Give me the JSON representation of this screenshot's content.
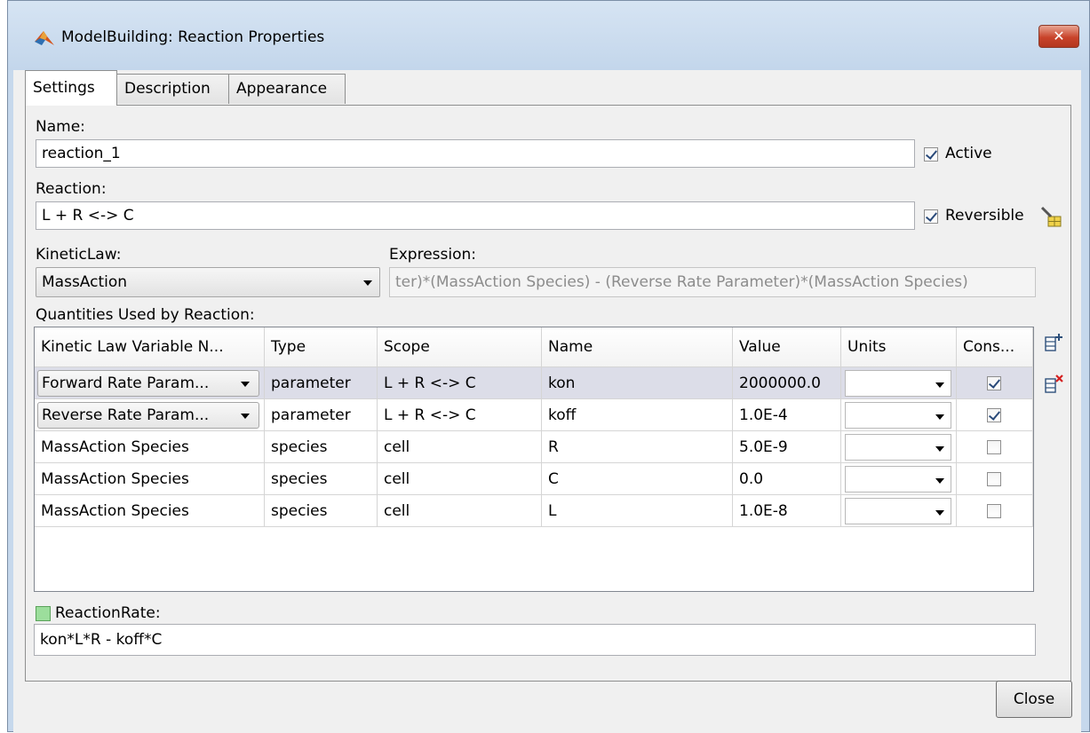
{
  "window": {
    "title": "ModelBuilding: Reaction Properties",
    "close_glyph": "✕"
  },
  "tabs": [
    {
      "label": "Settings",
      "active": true
    },
    {
      "label": "Description",
      "active": false
    },
    {
      "label": "Appearance",
      "active": false
    }
  ],
  "form": {
    "name_label": "Name:",
    "name_value": "reaction_1",
    "active_label": "Active",
    "active_checked": true,
    "reaction_label": "Reaction:",
    "reaction_value": "L + R <-> C",
    "reversible_label": "Reversible",
    "reversible_checked": true,
    "kinetic_law_label": "KineticLaw:",
    "kinetic_law_value": "MassAction",
    "expression_label": "Expression:",
    "expression_value": "ter)*(MassAction Species) - (Reverse Rate Parameter)*(MassAction Species)",
    "quantities_label": "Quantities Used by Reaction:",
    "reaction_rate_label": "ReactionRate:",
    "reaction_rate_value": "kon*L*R - koff*C"
  },
  "table": {
    "headers": [
      "Kinetic Law Variable N...",
      "Type",
      "Scope",
      "Name",
      "Value",
      "Units",
      "Cons..."
    ],
    "rows": [
      {
        "variable": "Forward Rate Param...",
        "type": "parameter",
        "scope": "L + R <-> C",
        "name": "kon",
        "value": "2000000.0",
        "units": "",
        "constant": true,
        "selected": true
      },
      {
        "variable": "Reverse Rate Param...",
        "type": "parameter",
        "scope": "L + R <-> C",
        "name": "koff",
        "value": "1.0E-4",
        "units": "",
        "constant": true,
        "selected": false
      },
      {
        "variable": "MassAction Species",
        "type": "species",
        "scope": "cell",
        "name": "R",
        "value": "5.0E-9",
        "units": "",
        "constant": false,
        "selected": false
      },
      {
        "variable": "MassAction Species",
        "type": "species",
        "scope": "cell",
        "name": "C",
        "value": "0.0",
        "units": "",
        "constant": false,
        "selected": false
      },
      {
        "variable": "MassAction Species",
        "type": "species",
        "scope": "cell",
        "name": "L",
        "value": "1.0E-8",
        "units": "",
        "constant": false,
        "selected": false
      }
    ]
  },
  "buttons": {
    "close_label": "Close"
  },
  "icons": [
    "matlab-logo-icon",
    "window-close-icon",
    "reaction-editor-icon",
    "add-row-icon",
    "delete-row-icon",
    "chevron-down-icon"
  ]
}
